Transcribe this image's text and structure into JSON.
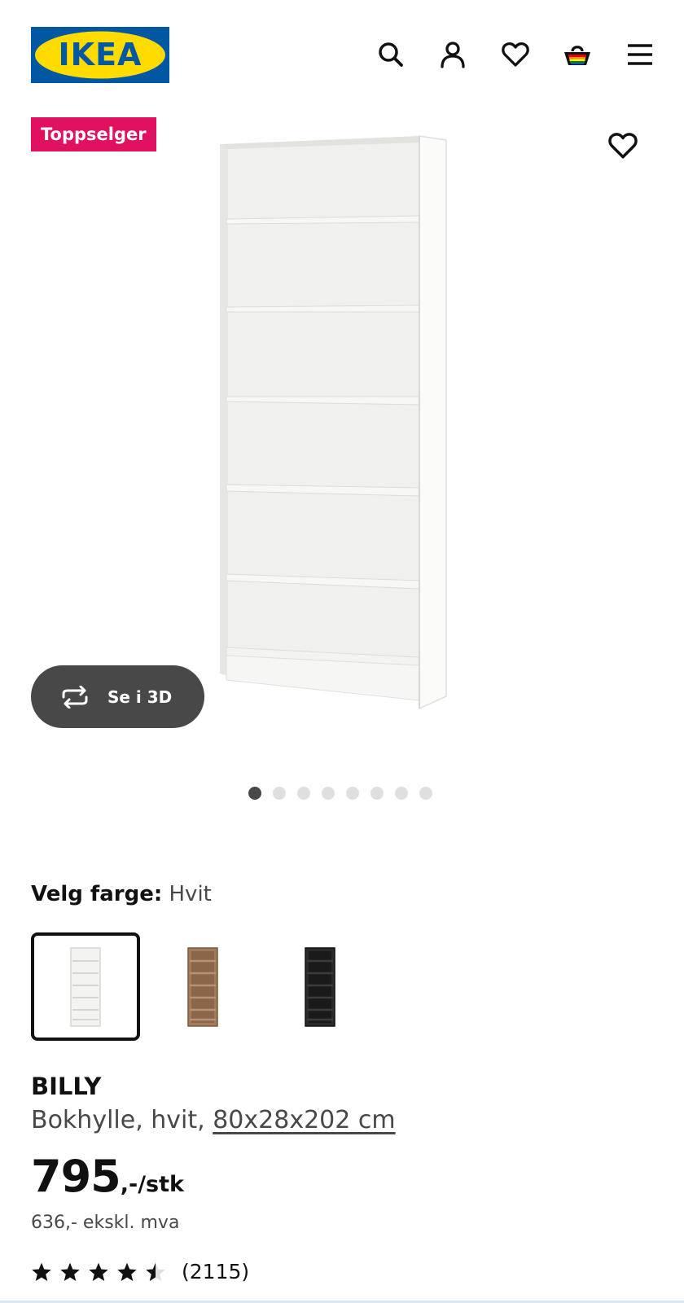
{
  "brand": {
    "logo_text": "IKEA",
    "colors": {
      "blue": "#0058a3",
      "yellow": "#ffdb00"
    }
  },
  "header": {
    "icons": [
      "search-icon",
      "account-icon",
      "heart-icon",
      "cart-icon",
      "menu-icon"
    ]
  },
  "gallery": {
    "badge": "Toppselger",
    "badge_color": "#e0115f",
    "view_3d_label": "Se i 3D",
    "image_count": 8,
    "active_index": 0
  },
  "color_picker": {
    "label": "Velg farge:",
    "selected": "Hvit",
    "options": [
      {
        "name": "Hvit",
        "color": "#f4f4f2"
      },
      {
        "name": "Brun",
        "color": "#a07a5a"
      },
      {
        "name": "Svart",
        "color": "#222222"
      }
    ]
  },
  "product": {
    "name": "BILLY",
    "description": "Bokhylle, hvit, ",
    "dimensions": "80x28x202 cm",
    "price_main": "795",
    "price_suffix": ",-/stk",
    "price_ex_vat": "636,- ekskl. mva",
    "rating": 4.5,
    "review_count": "(2115)"
  }
}
